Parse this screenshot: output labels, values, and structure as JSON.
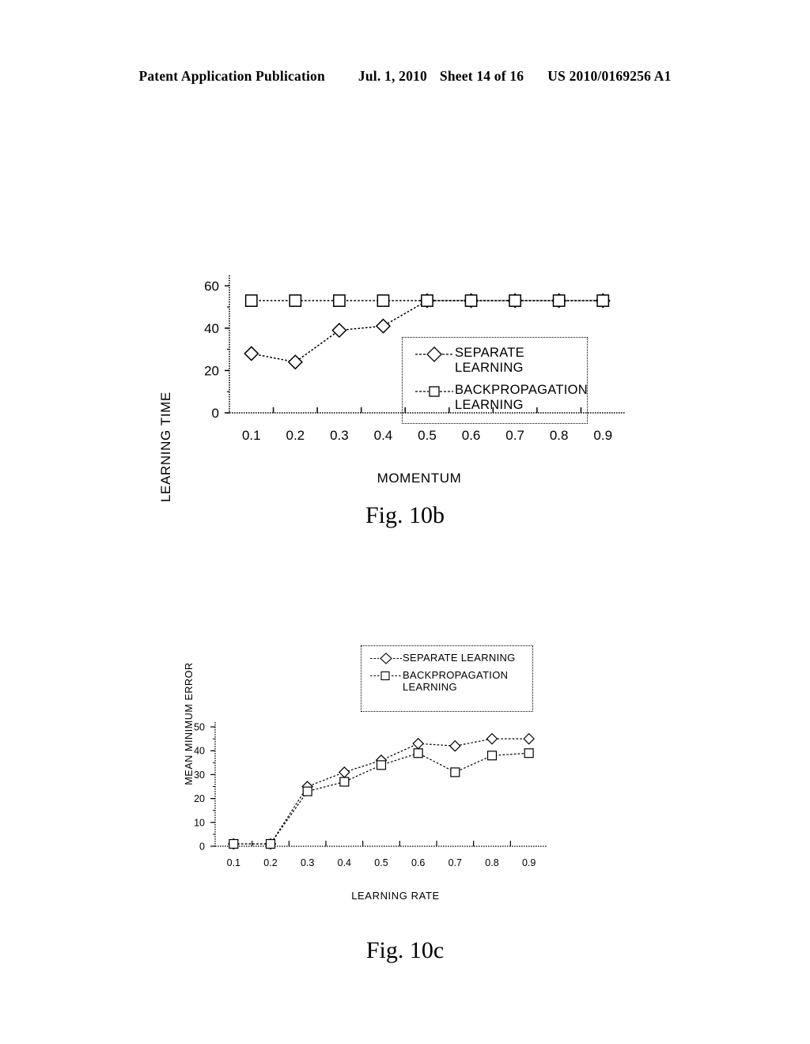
{
  "header": {
    "publication": "Patent Application Publication",
    "date": "Jul. 1, 2010",
    "sheet": "Sheet 14 of 16",
    "patent_number": "US 2010/0169256 A1"
  },
  "figures": [
    {
      "id": "10b",
      "caption": "Fig. 10b",
      "legend": {
        "items": [
          {
            "label": "SEPARATE LEARNING",
            "marker": "diamond"
          },
          {
            "label": "BACKPROPAGATION LEARNING",
            "marker": "square"
          }
        ]
      }
    },
    {
      "id": "10c",
      "caption": "Fig. 10c",
      "legend": {
        "items": [
          {
            "label": "SEPARATE LEARNING",
            "marker": "diamond"
          },
          {
            "label": "BACKPROPAGATION LEARNING",
            "marker": "square"
          }
        ]
      }
    }
  ],
  "chart_data": [
    {
      "type": "line",
      "figure": "10b",
      "title": "",
      "xlabel": "MOMENTUM",
      "ylabel": "LEARNING TIME",
      "categories": [
        "0.1",
        "0.2",
        "0.3",
        "0.4",
        "0.5",
        "0.6",
        "0.7",
        "0.8",
        "0.9"
      ],
      "xticklabels": [
        "0.1",
        "0.2",
        "0.3",
        "0.4",
        "0.5",
        "0.6",
        "0.7",
        "0.8",
        "0.9"
      ],
      "yticklabels": [
        "0",
        "20",
        "40",
        "60"
      ],
      "yticks": [
        0,
        20,
        40,
        60
      ],
      "ylim": [
        0,
        65
      ],
      "grid": false,
      "legend_position": "top-right",
      "series": [
        {
          "name": "SEPARATE LEARNING",
          "marker": "diamond",
          "linestyle": "dotted",
          "values": [
            28,
            24,
            39,
            41,
            53,
            53,
            53,
            53,
            53
          ]
        },
        {
          "name": "BACKPROPAGATION LEARNING",
          "marker": "square",
          "linestyle": "dotted",
          "values": [
            53,
            53,
            53,
            53,
            53,
            53,
            53,
            53,
            53
          ]
        }
      ]
    },
    {
      "type": "line",
      "figure": "10c",
      "title": "",
      "xlabel": "LEARNING RATE",
      "ylabel": "MEAN MINIMUM ERROR",
      "categories": [
        "0.1",
        "0.2",
        "0.3",
        "0.4",
        "0.5",
        "0.6",
        "0.7",
        "0.8",
        "0.9"
      ],
      "xticklabels": [
        "0.1",
        "0.2",
        "0.3",
        "0.4",
        "0.5",
        "0.6",
        "0.7",
        "0.8",
        "0.9"
      ],
      "yticklabels": [
        "0",
        "10",
        "20",
        "30",
        "40",
        "50"
      ],
      "yticks": [
        0,
        10,
        20,
        30,
        40,
        50
      ],
      "ylim": [
        0,
        52
      ],
      "grid": false,
      "legend_position": "top-center",
      "series": [
        {
          "name": "SEPARATE LEARNING",
          "marker": "diamond",
          "linestyle": "dotted",
          "values": [
            1,
            1,
            25,
            31,
            36,
            43,
            42,
            45,
            45
          ]
        },
        {
          "name": "BACKPROPAGATION LEARNING",
          "marker": "square",
          "linestyle": "dotted",
          "values": [
            1,
            1,
            23,
            27,
            34,
            39,
            31,
            38,
            39
          ]
        }
      ]
    }
  ]
}
